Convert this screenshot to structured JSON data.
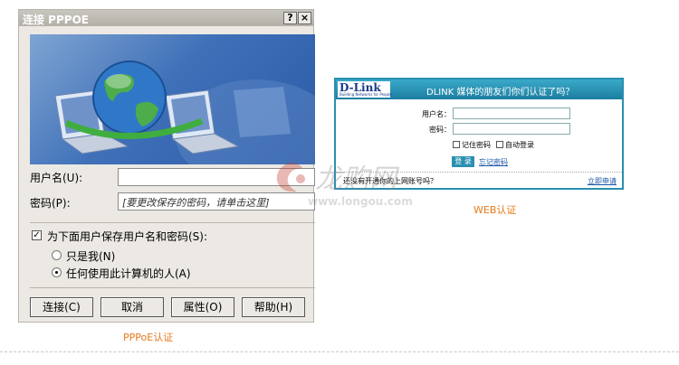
{
  "pppoe_dialog": {
    "title": "连接 PPPOE",
    "help_button": "?",
    "close_button": "×",
    "username_label": "用户名(U):",
    "username_value": "",
    "password_label": "密码(P):",
    "password_placeholder": "[要更改保存的密码，请单击这里]",
    "save_checkbox_label": "为下面用户保存用户名和密码(S):",
    "save_checked": true,
    "radio_only_me": "只是我(N)",
    "radio_anyone": "任何使用此计算机的人(A)",
    "selected_radio": "anyone",
    "buttons": {
      "connect": "连接(C)",
      "cancel": "取消",
      "properties": "属性(O)",
      "help": "帮助(H)"
    }
  },
  "web_login": {
    "logo_text": "D-Link",
    "logo_subtext": "Building Networks for People",
    "header_text": "DLINK 媒体的朋友们你们认证了吗？",
    "username_label": "用户名：",
    "password_label": "密码：",
    "remember_password": "记住密码",
    "auto_login": "自动登录",
    "login_button": "登 录",
    "forgot_password": "忘记密码",
    "register_prompt": "还没有开通你的上网账号吗？",
    "apply_link": "立即申请"
  },
  "watermark": {
    "brand": "龙购网",
    "site": "www.longou.com"
  },
  "captions": {
    "pppoe": "PPPoE认证",
    "web": "WEB认证"
  },
  "colors": {
    "caption": "#e67a1a",
    "web_header": "#2a8fb0",
    "banner": "#3f70b8"
  }
}
